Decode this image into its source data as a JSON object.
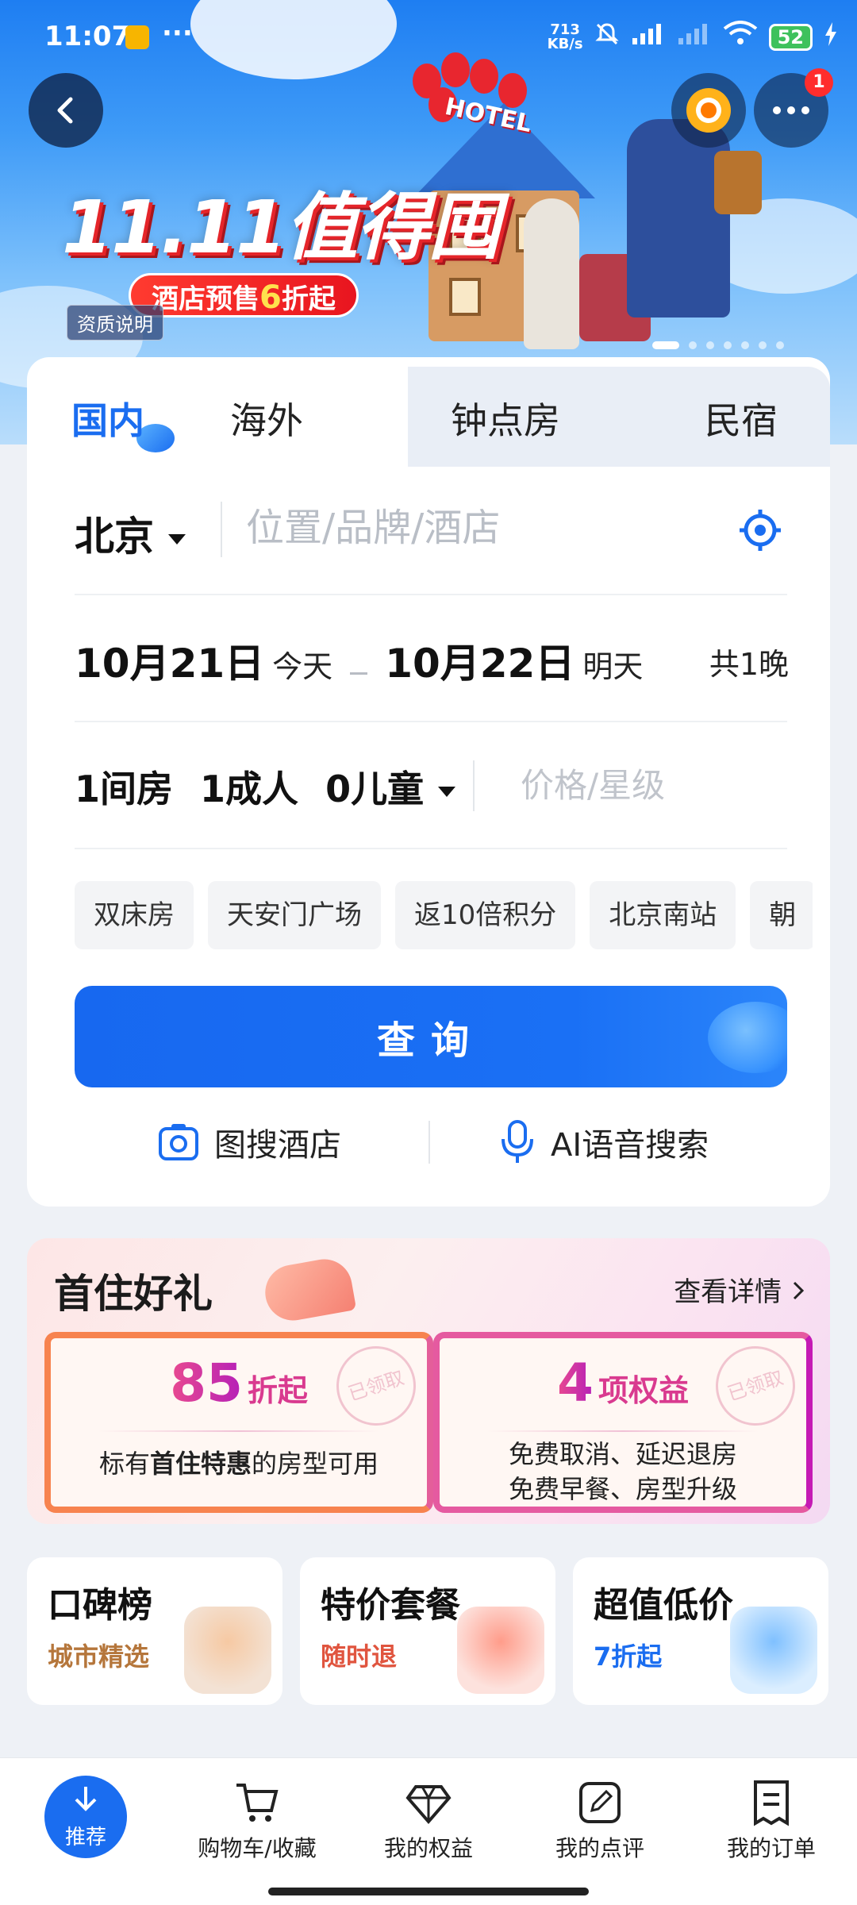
{
  "status_bar": {
    "time": "11:07",
    "dots": "···",
    "net_speed_value": "713",
    "net_speed_unit": "KB/s",
    "battery": "52"
  },
  "banner": {
    "title": "11.11值得囤",
    "subtitle_prefix": "酒店预售",
    "subtitle_highlight": "6",
    "subtitle_suffix": "折起",
    "hotel_sign": "HOTEL",
    "qualification": "资质说明",
    "notification_count": "1"
  },
  "tabs": [
    {
      "label": "国内",
      "active": true
    },
    {
      "label": "海外",
      "active": false
    },
    {
      "label": "钟点房",
      "active": false
    },
    {
      "label": "民宿",
      "active": false
    }
  ],
  "search": {
    "city": "北京",
    "placeholder": "位置/品牌/酒店"
  },
  "dates": {
    "checkin": "10月21日",
    "checkin_label": "今天",
    "checkout": "10月22日",
    "checkout_label": "明天",
    "nights": "共1晚"
  },
  "guests": {
    "rooms": "1间房",
    "adults": "1成人",
    "children": "0儿童",
    "price_placeholder": "价格/星级"
  },
  "chips": [
    "双床房",
    "天安门广场",
    "返10倍积分",
    "北京南站",
    "朝"
  ],
  "query_button": "查询",
  "tools": {
    "image_search": "图搜酒店",
    "voice_search": "AI语音搜索"
  },
  "gift": {
    "title": "首住好礼",
    "detail_link": "查看详情",
    "left": {
      "number": "85",
      "unit": "折起",
      "desc_prefix": "标有",
      "desc_bold": "首住特惠",
      "desc_suffix": "的房型可用",
      "stamp": "已领取"
    },
    "right": {
      "number": "4",
      "unit": "项权益",
      "desc_line1": "免费取消、延迟退房",
      "desc_line2": "免费早餐、房型升级",
      "stamp": "已领取"
    }
  },
  "tiles": [
    {
      "title": "口碑榜",
      "subtitle": "城市精选",
      "color": "#b5763b"
    },
    {
      "title": "特价套餐",
      "subtitle": "随时退",
      "color": "#e0553f"
    },
    {
      "title": "超值低价",
      "subtitle": "7折起",
      "color": "#1a6df0"
    }
  ],
  "bottom_nav": [
    {
      "label": "推荐",
      "active": true
    },
    {
      "label": "购物车/收藏"
    },
    {
      "label": "我的权益"
    },
    {
      "label": "我的点评"
    },
    {
      "label": "我的订单"
    }
  ],
  "colors": {
    "primary": "#1a6df0",
    "promo_red": "#e5252a",
    "gift_pink": "#e94a8f"
  }
}
